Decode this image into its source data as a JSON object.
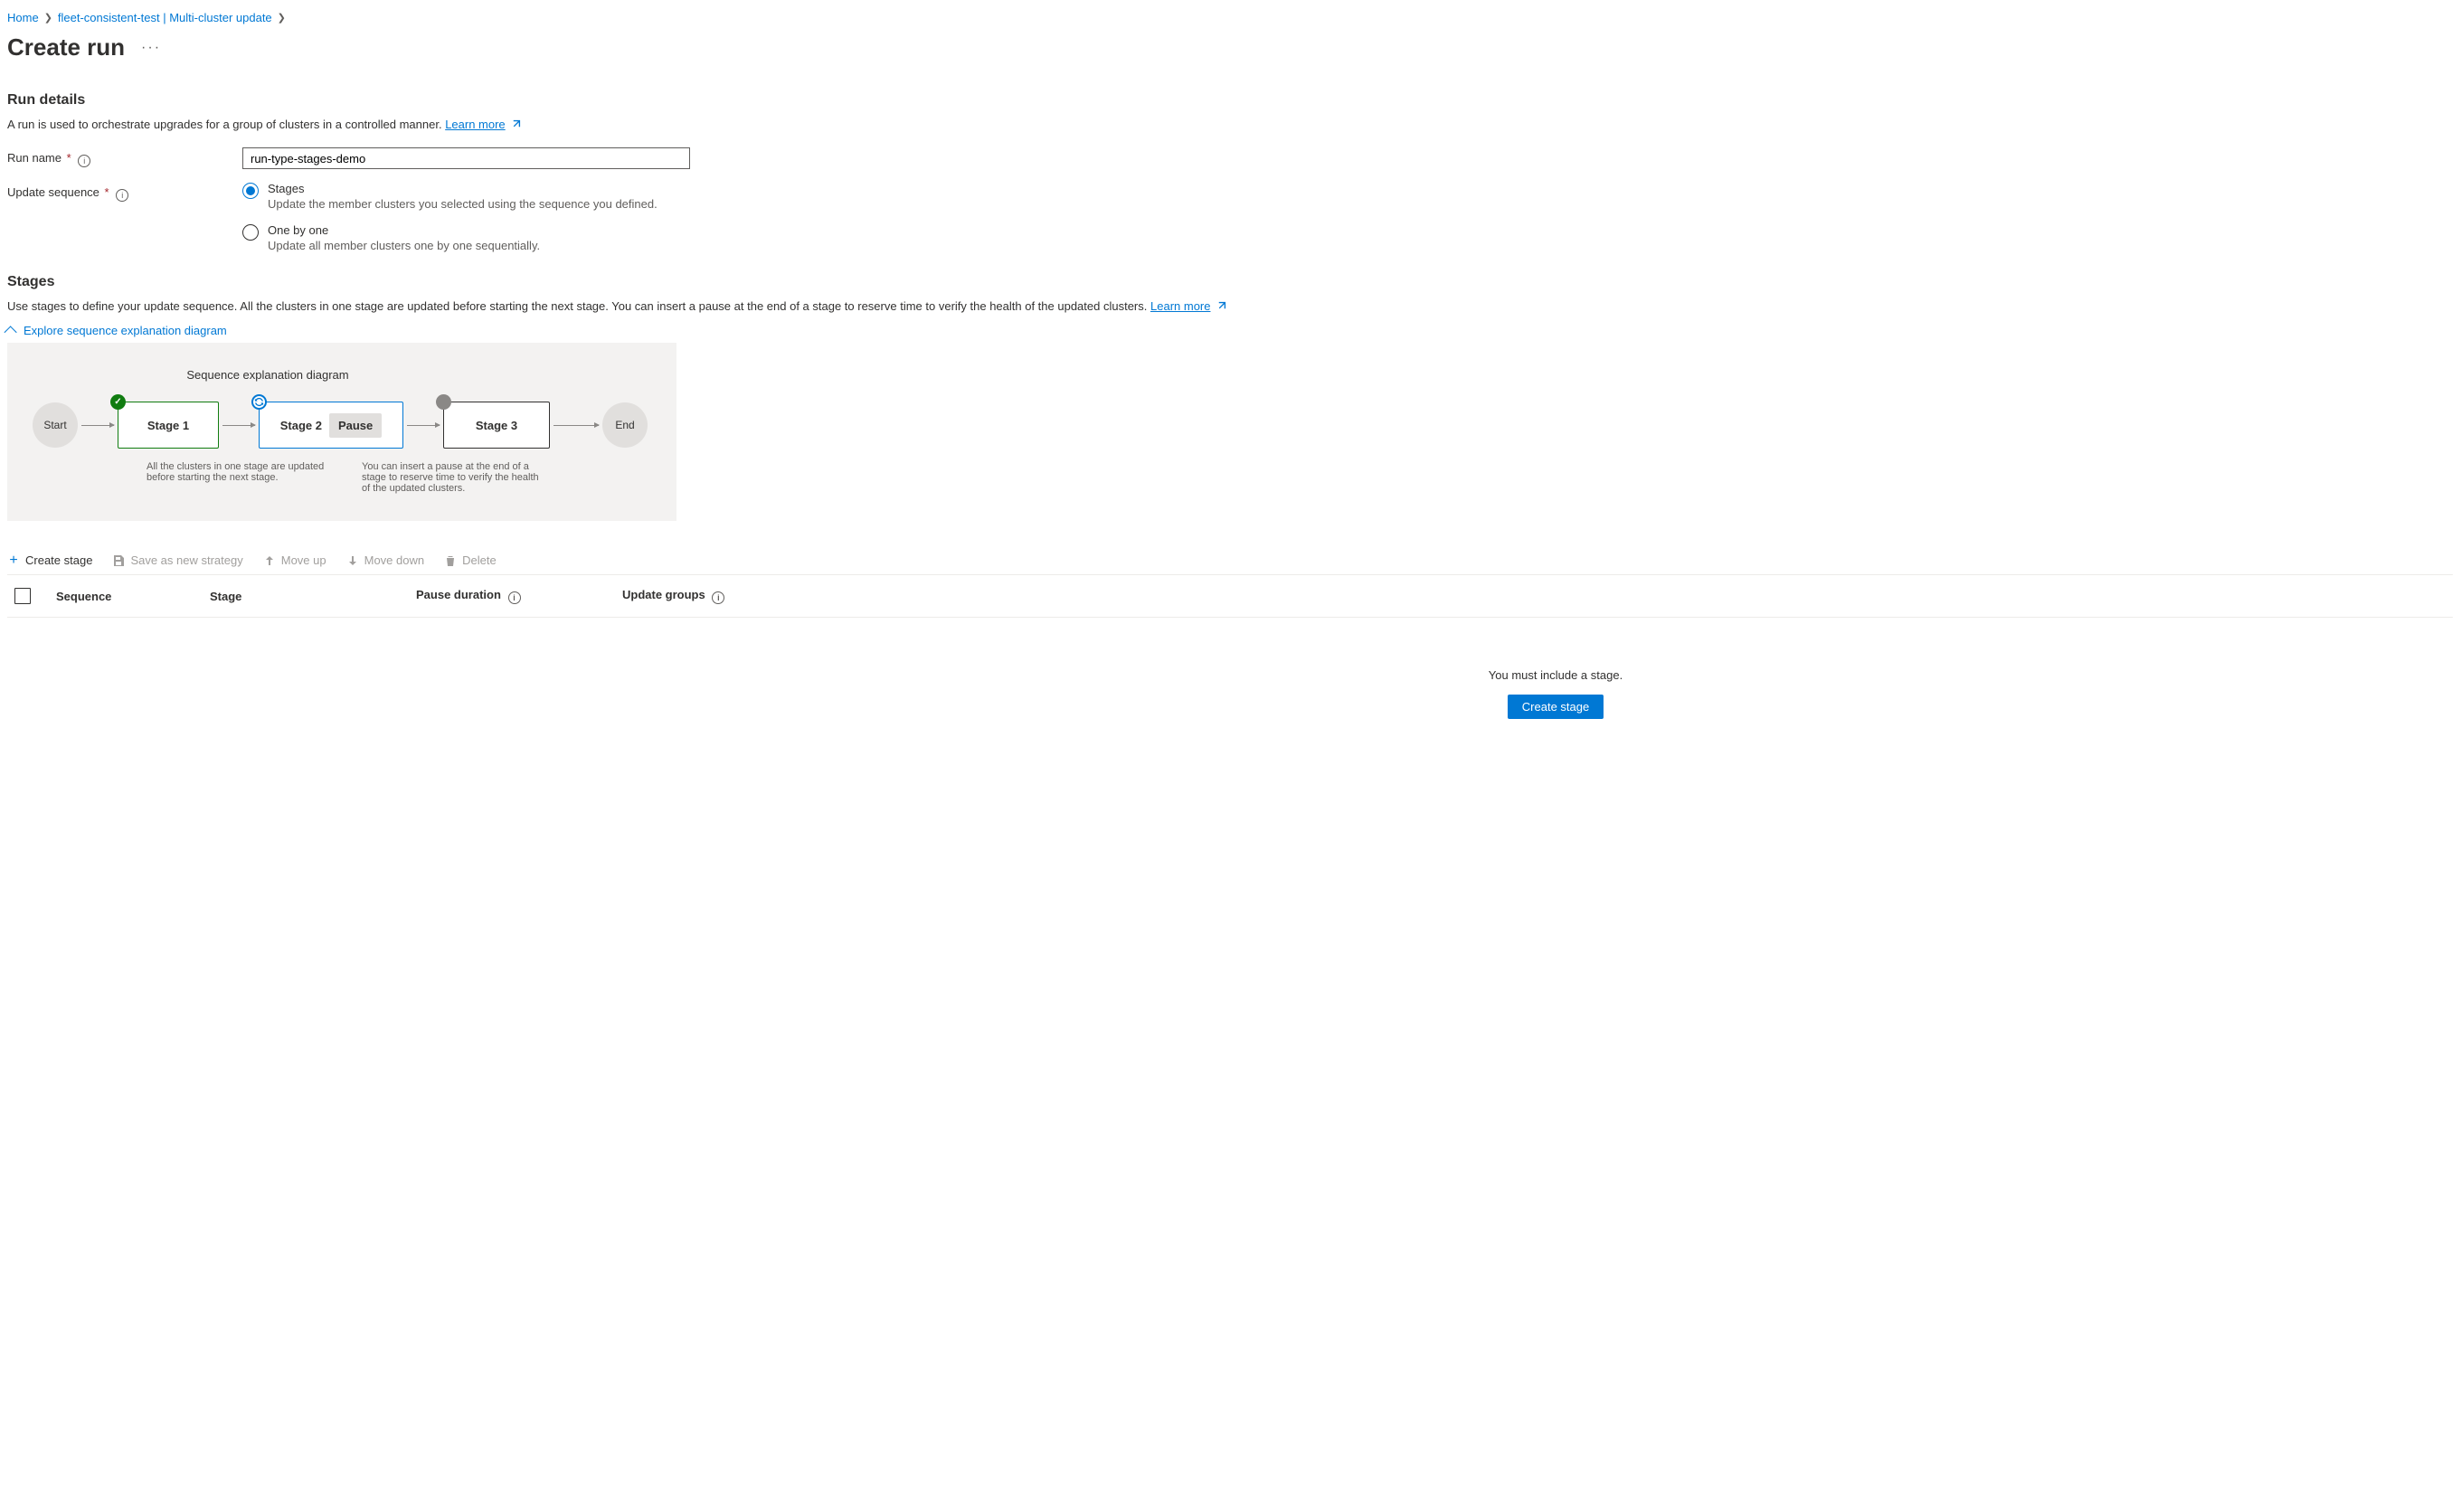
{
  "breadcrumb": {
    "home": "Home",
    "fleet": "fleet-consistent-test | Multi-cluster update"
  },
  "title": "Create run",
  "run_details": {
    "heading": "Run details",
    "desc": "A run is used to orchestrate upgrades for a group of clusters in a controlled manner.",
    "learn_more": "Learn more",
    "run_name_label": "Run name",
    "run_name_value": "run-type-stages-demo",
    "update_seq_label": "Update sequence",
    "opt_stages_label": "Stages",
    "opt_stages_desc": "Update the member clusters you selected using the sequence you defined.",
    "opt_one_label": "One by one",
    "opt_one_desc": "Update all member clusters one by one sequentially."
  },
  "stages_section": {
    "heading": "Stages",
    "desc": "Use stages to define your update sequence. All the clusters in one stage are updated before starting the next stage. You can insert a pause at the end of a stage to reserve time to verify the health of the updated clusters.",
    "learn_more": "Learn more",
    "toggle": "Explore sequence explanation diagram",
    "diagram_title": "Sequence explanation diagram",
    "start": "Start",
    "stage1": "Stage 1",
    "stage2": "Stage 2",
    "pause": "Pause",
    "stage3": "Stage 3",
    "end": "End",
    "note1": "All the clusters in one stage are updated before starting the next stage.",
    "note2": "You can insert a pause at the end of a stage to reserve time to verify the health of the updated clusters."
  },
  "toolbar": {
    "create_stage": "Create stage",
    "save_strategy": "Save as new strategy",
    "move_up": "Move up",
    "move_down": "Move down",
    "delete": "Delete"
  },
  "table": {
    "col_sequence": "Sequence",
    "col_stage": "Stage",
    "col_pause": "Pause duration",
    "col_groups": "Update groups"
  },
  "empty": {
    "msg": "You must include a stage.",
    "btn": "Create stage"
  }
}
